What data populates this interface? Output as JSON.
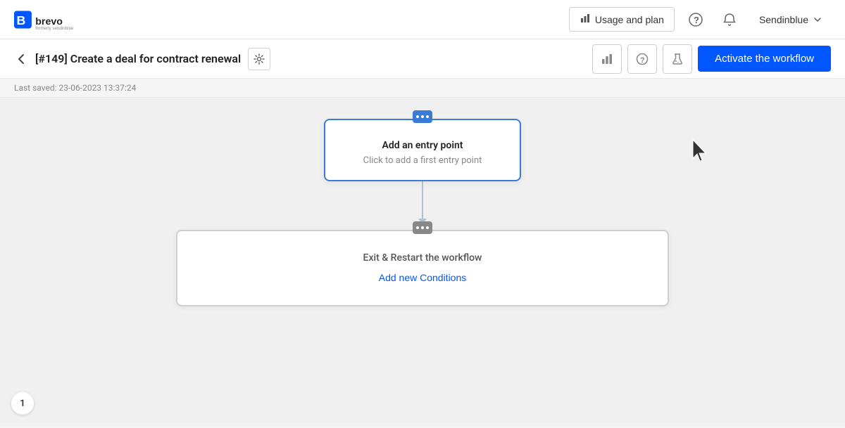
{
  "header": {
    "logo_alt": "Brevo (formerly Sendinblue)",
    "usage_plan_label": "Usage and plan",
    "notification_icon": "bell",
    "help_icon": "question-mark",
    "user_label": "Sendinblue",
    "chevron_icon": "chevron-down"
  },
  "subheader": {
    "back_icon": "arrow-left",
    "page_title": "[#149] Create a deal for contract renewal",
    "settings_icon": "gear",
    "toolbar": {
      "chart_icon": "bar-chart",
      "question_icon": "question-circle",
      "flask_icon": "flask"
    },
    "activate_btn_label": "Activate the workflow"
  },
  "timestamp": {
    "text": "Last saved: 23-06-2023 13:37:24"
  },
  "canvas": {
    "entry_card": {
      "title": "Add an entry point",
      "subtitle": "Click to add a first entry point"
    },
    "exit_card": {
      "title": "Exit & Restart the workflow",
      "add_conditions_label": "Add new Conditions"
    }
  },
  "page_number": "1"
}
